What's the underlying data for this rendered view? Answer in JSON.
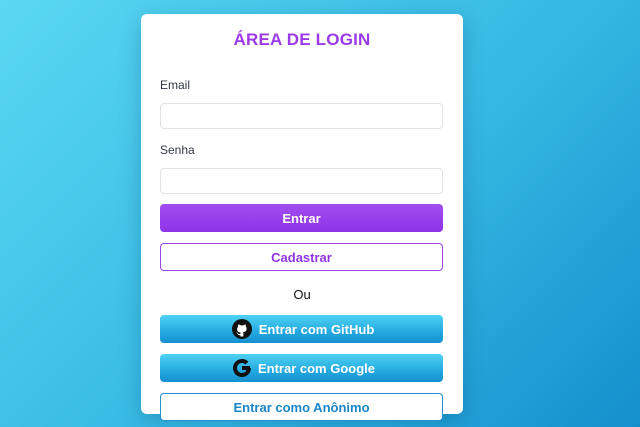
{
  "login": {
    "title": "ÁREA DE LOGIN",
    "email_label": "Email",
    "email_value": "",
    "senha_label": "Senha",
    "senha_value": "",
    "entrar_label": "Entrar",
    "cadastrar_label": "Cadastrar",
    "divider_text": "Ou",
    "github_label": "Entrar com GitHub",
    "github_icon": "github-icon",
    "google_label": "Entrar com Google",
    "google_icon": "google-icon",
    "anon_label": "Entrar como Anônimo"
  },
  "colors": {
    "accent_purple": "#9b3ae6",
    "accent_blue": "#23a9e0",
    "background_start": "#5ad8f3",
    "background_end": "#148fcd"
  }
}
